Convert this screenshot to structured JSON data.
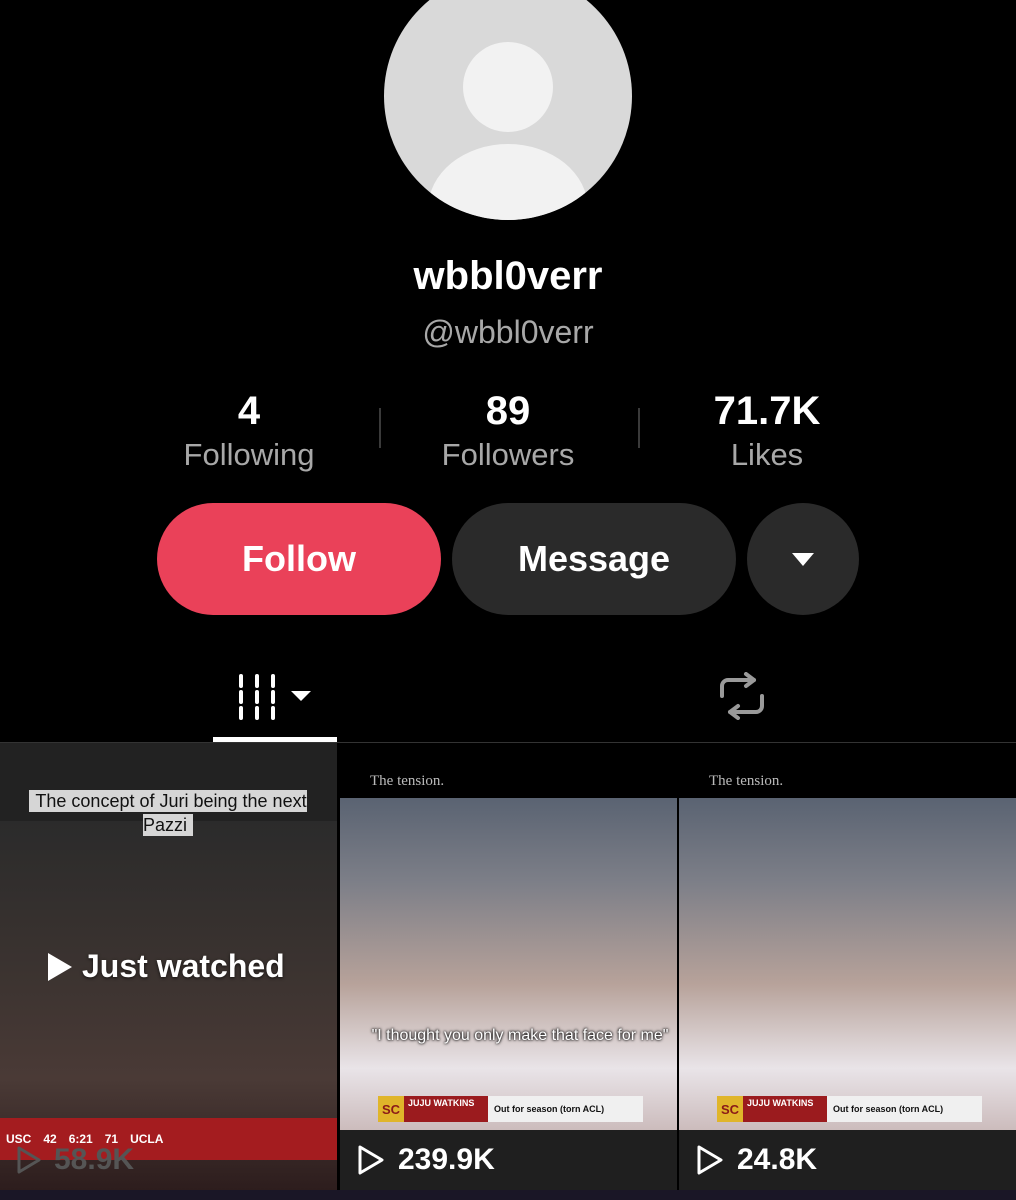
{
  "profile": {
    "display_name": "wbbl0verr",
    "handle": "@wbbl0verr"
  },
  "stats": [
    {
      "value": "4",
      "label": "Following"
    },
    {
      "value": "89",
      "label": "Followers"
    },
    {
      "value": "71.7K",
      "label": "Likes"
    }
  ],
  "actions": {
    "follow_label": "Follow",
    "message_label": "Message"
  },
  "tabs": {
    "videos_icon": "grid-icon",
    "reposts_icon": "repost-icon"
  },
  "videos": [
    {
      "caption": "The concept of Juri being the next Pazzi",
      "badge": "Just watched",
      "views": "58.9K",
      "scoreboard": {
        "home": "USC",
        "home_score": "42",
        "clock": "6:21",
        "away_score": "71",
        "away": "UCLA"
      }
    },
    {
      "header": "The tension.",
      "subtitle": "\"I thought you only make that face for me\"",
      "bug_player": "JUJU WATKINS",
      "bug_note": "Out for season (torn ACL)",
      "views": "239.9K"
    },
    {
      "header": "The tension.",
      "bug_player": "JUJU WATKINS",
      "bug_note": "Out for season (torn ACL)",
      "views": "24.8K"
    }
  ],
  "colors": {
    "follow": "#ea4159",
    "secondary_button": "#2a2a2a",
    "background": "#000000"
  }
}
